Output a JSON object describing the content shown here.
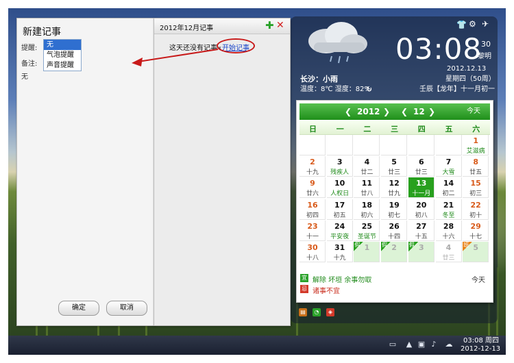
{
  "note_panel": {
    "title": "新建记事",
    "remind_label": "提醒:",
    "remark_label": "备注:",
    "remark_value": "无",
    "remind_options": [
      "无",
      "气泡提醒",
      "声音提醒"
    ],
    "remind_selected": "无",
    "ok_button": "确定",
    "cancel_button": "取消"
  },
  "month_panel": {
    "title": "2012年12月记事",
    "empty_text": "这天还没有记事«",
    "start_link": "开始记事"
  },
  "widget": {
    "clock": "03:08",
    "seconds": "30",
    "period": "黎明",
    "date": "2012.12.13",
    "weekday_week": "星期四（50周）",
    "lunar": "壬辰【龙年】十一月初一",
    "weather_city": "长沙：小雨",
    "weather_detail": "温度：8℃ 湿度：82%"
  },
  "calendar": {
    "year": "2012",
    "month": "12",
    "today_button": "今天",
    "weekdays": [
      "日",
      "一",
      "二",
      "三",
      "四",
      "五",
      "六"
    ],
    "holiday_mark": "假",
    "work_mark": "班",
    "suitable_badge": "宜",
    "suitable_text": "解除 坏垣 余事勿取",
    "avoid_badge": "忌",
    "avoid_text": "诸事不宜",
    "today_label": "今天",
    "rows": [
      [
        null,
        null,
        null,
        null,
        null,
        null,
        {
          "d": "1",
          "l": "艾滋病",
          "wk": true,
          "fest": true
        }
      ],
      [
        {
          "d": "2",
          "l": "十九",
          "wk": true
        },
        {
          "d": "3",
          "l": "残疾人",
          "fest": true
        },
        {
          "d": "4",
          "l": "廿二"
        },
        {
          "d": "5",
          "l": "廿三"
        },
        {
          "d": "6",
          "l": "廿三"
        },
        {
          "d": "7",
          "l": "大雪",
          "fest": true
        },
        {
          "d": "8",
          "l": "廿五",
          "wk": true
        }
      ],
      [
        {
          "d": "9",
          "l": "廿六",
          "wk": true
        },
        {
          "d": "10",
          "l": "人权日",
          "fest": true
        },
        {
          "d": "11",
          "l": "廿八"
        },
        {
          "d": "12",
          "l": "廿九"
        },
        {
          "d": "13",
          "l": "十一月",
          "today": true
        },
        {
          "d": "14",
          "l": "初二"
        },
        {
          "d": "15",
          "l": "初三",
          "wk": true
        }
      ],
      [
        {
          "d": "16",
          "l": "初四",
          "wk": true
        },
        {
          "d": "17",
          "l": "初五"
        },
        {
          "d": "18",
          "l": "初六"
        },
        {
          "d": "19",
          "l": "初七"
        },
        {
          "d": "20",
          "l": "初八"
        },
        {
          "d": "21",
          "l": "冬至",
          "fest": true
        },
        {
          "d": "22",
          "l": "初十",
          "wk": true
        }
      ],
      [
        {
          "d": "23",
          "l": "十一",
          "wk": true
        },
        {
          "d": "24",
          "l": "平安夜",
          "fest": true
        },
        {
          "d": "25",
          "l": "圣诞节",
          "fest": true
        },
        {
          "d": "26",
          "l": "十四"
        },
        {
          "d": "27",
          "l": "十五"
        },
        {
          "d": "28",
          "l": "十六"
        },
        {
          "d": "29",
          "l": "十七",
          "wk": true
        }
      ],
      [
        {
          "d": "30",
          "l": "十八",
          "wk": true
        },
        {
          "d": "31",
          "l": "十九"
        },
        {
          "d": "1",
          "l": "",
          "hol": true,
          "dim": true,
          "mark": "假"
        },
        {
          "d": "2",
          "l": "",
          "hol": true,
          "dim": true,
          "mark": "假"
        },
        {
          "d": "3",
          "l": "",
          "hol": true,
          "dim": true,
          "mark": "假"
        },
        {
          "d": "4",
          "l": "廿三",
          "dim": true
        },
        {
          "d": "5",
          "l": "",
          "dim": true,
          "hol": true,
          "mark": "班"
        }
      ]
    ]
  },
  "taskbar": {
    "time": "03:08 周四",
    "date": "2012-12-13"
  },
  "colors": {
    "accent_green": "#28a01e",
    "annotation_red": "#c81a1a",
    "link_blue": "#1a45c8"
  },
  "icons": [
    "shirt-icon",
    "gear-icon",
    "pin-icon",
    "refresh-icon",
    "add-icon",
    "close-icon",
    "cloud-rain-icon"
  ]
}
